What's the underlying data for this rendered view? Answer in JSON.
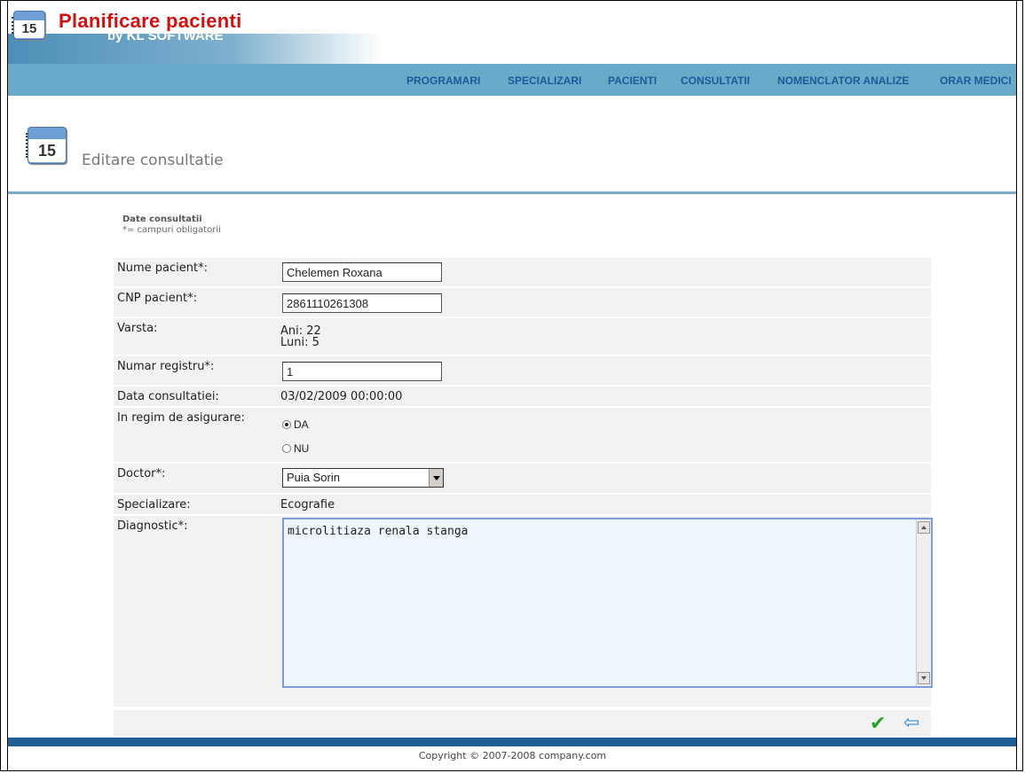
{
  "header": {
    "app_title": "Planificare pacienti",
    "app_subtitle": "by KL SOFTWARE",
    "logo_number": "15"
  },
  "nav": {
    "items": [
      "PROGRAMARI",
      "SPECIALIZARI",
      "PACIENTI",
      "CONSULTATII",
      "NOMENCLATOR ANALIZE",
      "ORAR MEDICI"
    ]
  },
  "page": {
    "title": "Editare consultatie",
    "icon_number": "15"
  },
  "section": {
    "title": "Date consultatii",
    "note": "*= campuri obligatorii"
  },
  "form": {
    "nume_label": "Nume pacient*:",
    "nume_value": "Chelemen Roxana",
    "cnp_label": "CNP pacient*:",
    "cnp_value": "2861110261308",
    "varsta_label": "Varsta:",
    "varsta_ani": "Ani: 22",
    "varsta_luni": "Luni: 5",
    "registru_label": "Numar registru*:",
    "registru_value": "1",
    "data_label": "Data consultatiei:",
    "data_value": "03/02/2009 00:00:00",
    "asigurare_label": "In regim de asigurare:",
    "asigurare_options": [
      "DA",
      "NU"
    ],
    "asigurare_selected": "DA",
    "doctor_label": "Doctor*:",
    "doctor_value": "Puia Sorin",
    "specializare_label": "Specializare:",
    "specializare_value": "Ecografie",
    "diagnostic_label": "Diagnostic*:",
    "diagnostic_value": "microlitiaza renala stanga"
  },
  "actions": {
    "save_icon": "checkmark-icon",
    "back_icon": "back-arrow-icon"
  },
  "footer": {
    "copyright": "Copyright © 2007-2008 company.com"
  },
  "colors": {
    "nav_bg": "#6aaac9",
    "nav_text": "#1e5a9a",
    "title_red": "#d01010",
    "footer_bar": "#1f5f95"
  }
}
